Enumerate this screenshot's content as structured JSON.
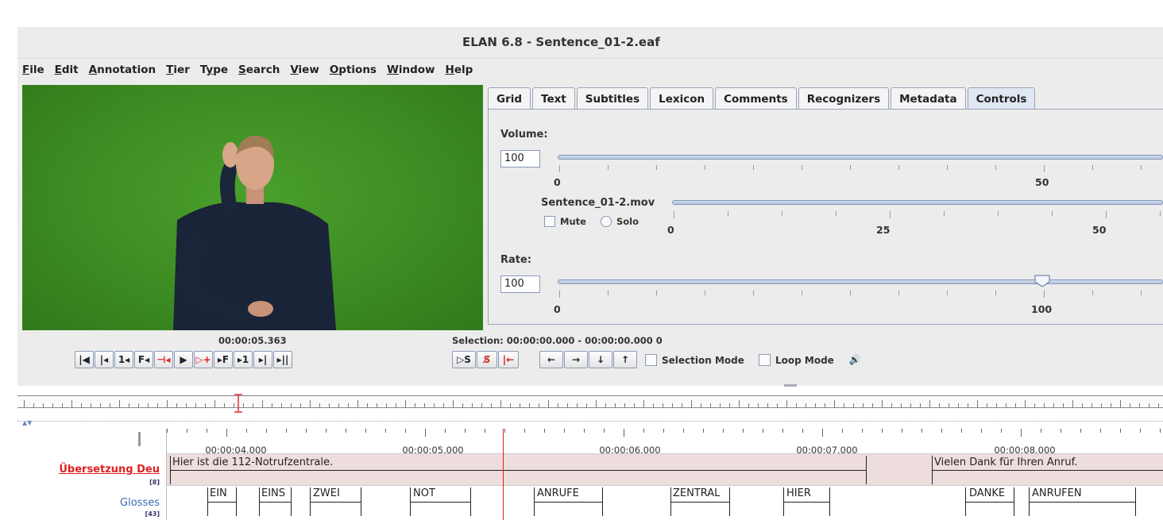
{
  "window": {
    "title": "ELAN 6.8 - Sentence_01-2.eaf"
  },
  "menu": [
    {
      "u": "F",
      "rest": "ile"
    },
    {
      "u": "E",
      "rest": "dit"
    },
    {
      "u": "A",
      "rest": "nnotation"
    },
    {
      "u": "T",
      "rest": "ier"
    },
    {
      "u": "",
      "pre": "T",
      "u2": "y",
      "rest": "pe"
    },
    {
      "u": "S",
      "rest": "earch"
    },
    {
      "u": "V",
      "rest": "iew"
    },
    {
      "u": "O",
      "rest": "ptions"
    },
    {
      "u": "W",
      "rest": "indow"
    },
    {
      "u": "H",
      "rest": "elp"
    }
  ],
  "player": {
    "time": "00:00:05.363",
    "selection": "Selection: 00:00:00.000 - 00:00:00.000  0",
    "selection_mode": "Selection Mode",
    "loop_mode": "Loop Mode"
  },
  "tabs": [
    "Grid",
    "Text",
    "Subtitles",
    "Lexicon",
    "Comments",
    "Recognizers",
    "Metadata",
    "Controls"
  ],
  "active_tab": "Controls",
  "controls": {
    "volume_label": "Volume:",
    "volume_value": "100",
    "volume_ticks": [
      "0",
      "50"
    ],
    "media_file": "Sentence_01-2.mov",
    "mute": "Mute",
    "solo": "Solo",
    "media_ticks": [
      "0",
      "25",
      "50"
    ],
    "rate_label": "Rate:",
    "rate_value": "100",
    "rate_ticks": [
      "0",
      "100"
    ],
    "rate_level": 100
  },
  "timeline": {
    "ruler_times": [
      "00:00:04.000",
      "00:00:05.000",
      "00:00:06.000",
      "00:00:07.000",
      "00:00:08.000"
    ],
    "tiers": [
      {
        "name": "Übersetzung Deu",
        "count": "[8]"
      },
      {
        "name": "Glosses",
        "count": "[43]"
      }
    ],
    "translation": [
      "Hier ist die 112-Notrufzentrale.",
      "Vielen Dank für Ihren Anruf."
    ],
    "glosses": [
      "EIN",
      "EINS",
      "ZWEI",
      "NOT",
      "ANRUFE",
      "ZENTRAL",
      "HIER",
      "DANKE",
      "ANRUFEN"
    ]
  }
}
